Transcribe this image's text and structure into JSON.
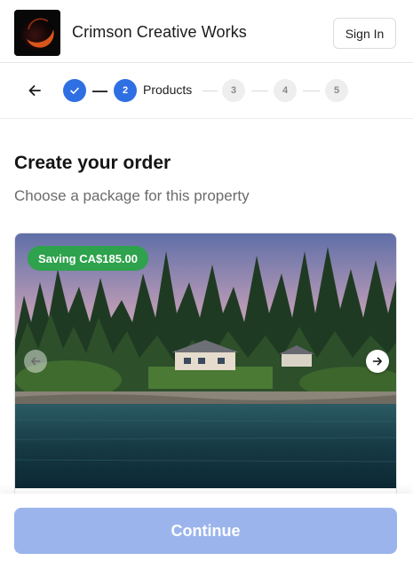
{
  "header": {
    "brand": "Crimson Creative Works",
    "sign_in_label": "Sign In",
    "logo_icon": "crimson-moon-logo"
  },
  "stepper": {
    "back_icon": "arrow-left-icon",
    "steps": [
      {
        "number": "",
        "state": "completed",
        "icon": "check-icon"
      },
      {
        "number": "2",
        "state": "active",
        "label": "Products"
      },
      {
        "number": "3",
        "state": "upcoming"
      },
      {
        "number": "4",
        "state": "upcoming"
      },
      {
        "number": "5",
        "state": "upcoming"
      }
    ],
    "colors": {
      "active": "#2f6fe4",
      "upcoming": "#eeeeee"
    }
  },
  "main": {
    "title": "Create your order",
    "subtitle": "Choose a package for this property",
    "package_card": {
      "badge": "Saving CA$185.00",
      "badge_color": "#2ea24c",
      "prev_icon": "arrow-left-icon",
      "next_icon": "arrow-right-icon"
    }
  },
  "footer": {
    "continue_label": "Continue",
    "continue_color": "#9bb4ec"
  }
}
